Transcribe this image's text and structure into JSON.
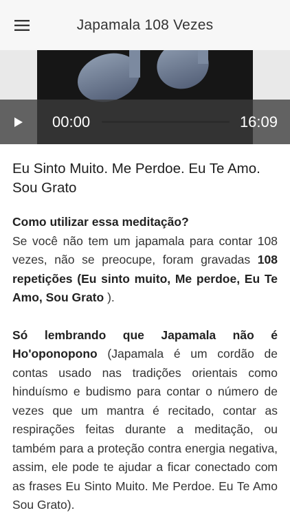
{
  "appbar": {
    "title": "Japamala 108 Vezes",
    "menu_icon": "hamburger-menu-icon"
  },
  "player": {
    "artwork_icon": "music-note-icon",
    "play_icon": "play-icon",
    "current_time": "00:00",
    "total_time": "16:09",
    "progress": 0
  },
  "content": {
    "track_title": "Eu Sinto Muito. Me Perdoe. Eu Te Amo. Sou Grato",
    "how_to_heading": "Como utilizar essa meditação?",
    "p1_text": "Se você não tem um japamala para contar 108 vezes, não se preocupe, foram gravadas ",
    "p1_bold": "108 repetições (Eu sinto muito, Me perdoe, Eu Te Amo, Sou Grato",
    "p1_end": " ).",
    "p2_bold": "Só lembrando que Japamala não é Ho'oponopono",
    "p2_text": " (Japamala é um cordão de contas usado nas tradições orientais como hinduísmo e budismo para contar o número de vezes que um mantra é recitado, contar as respirações feitas durante a meditação, ou também para a proteção contra energia negativa, assim, ele pode te ajudar a ficar conectado com as frases Eu Sinto Muito. Me Perdoe. Eu Te Amo Sou Grato)."
  }
}
